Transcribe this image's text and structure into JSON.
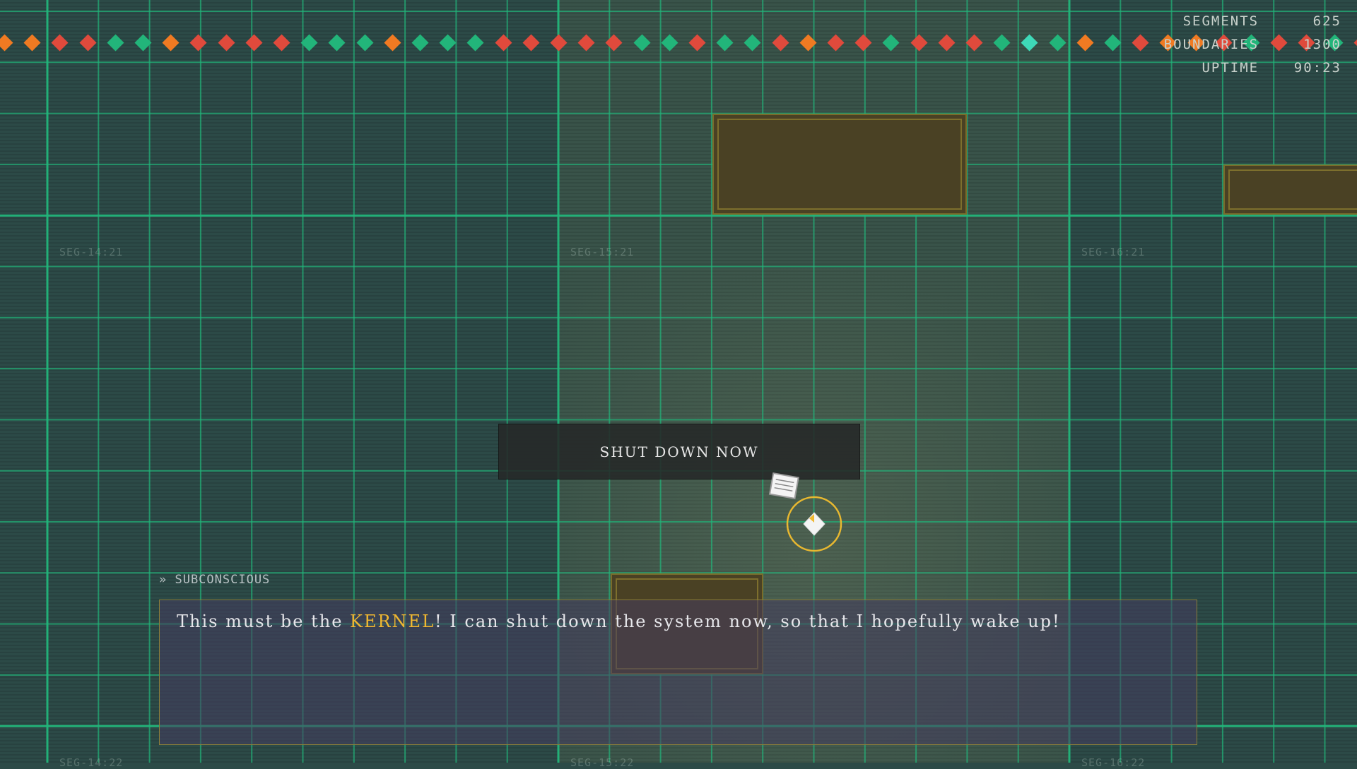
{
  "hud": {
    "rows": [
      {
        "label": "SEGMENTS",
        "value": "625"
      },
      {
        "label": "BOUNDARIES",
        "value": "1300"
      },
      {
        "label": "UPTIME",
        "value": "90:23"
      }
    ]
  },
  "segment_labels": [
    "SEG-14:21",
    "SEG-15:21",
    "SEG-16:21",
    "SEG-14:22",
    "SEG-15:22",
    "SEG-16:22"
  ],
  "boundary_markers": {
    "colors": {
      "red": "#e04a3c",
      "orange": "#f07a22",
      "green": "#22b57a",
      "teal": "#3ed9b8"
    },
    "sequence": [
      "orange",
      "orange",
      "red",
      "red",
      "green",
      "green",
      "orange",
      "red",
      "red",
      "red",
      "red",
      "green",
      "green",
      "green",
      "orange",
      "green",
      "green",
      "green",
      "red",
      "red",
      "red",
      "red",
      "red",
      "green",
      "green",
      "red",
      "green",
      "green",
      "red",
      "orange",
      "red",
      "red",
      "green",
      "red",
      "red",
      "red",
      "green",
      "teal",
      "green",
      "orange",
      "green",
      "red",
      "orange",
      "orange",
      "red",
      "green",
      "red",
      "red",
      "green",
      "red"
    ]
  },
  "prompt": {
    "label": "SHUT DOWN NOW"
  },
  "dialogue": {
    "speaker": "» SUBCONSCIOUS",
    "text_before": "This must be the ",
    "highlight": "KERNEL",
    "text_after": "! I can shut down the system now, so that I hopefully wake up!"
  },
  "colors": {
    "grid_line": "#22b57a",
    "background": "#2c4a47",
    "accent": "#f0b830",
    "block": "#4a4124"
  },
  "icons": {
    "player": "player-marker-icon",
    "note": "note-icon"
  }
}
